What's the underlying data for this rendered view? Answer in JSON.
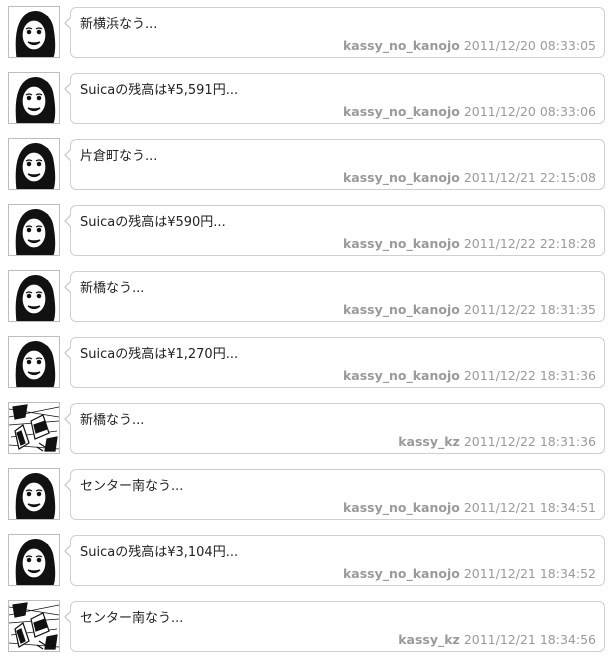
{
  "timeline": {
    "items": [
      {
        "avatar": "girl-face-icon",
        "text": "新横浜なう...",
        "user": "kassy_no_kanojo",
        "time": "2011/12/20 08:33:05"
      },
      {
        "avatar": "girl-face-icon",
        "text": "Suicaの残高は¥5,591円...",
        "user": "kassy_no_kanojo",
        "time": "2011/12/20 08:33:06"
      },
      {
        "avatar": "girl-face-icon",
        "text": "片倉町なう...",
        "user": "kassy_no_kanojo",
        "time": "2011/12/21 22:15:08"
      },
      {
        "avatar": "girl-face-icon",
        "text": "Suicaの残高は¥590円...",
        "user": "kassy_no_kanojo",
        "time": "2011/12/22 22:18:28"
      },
      {
        "avatar": "girl-face-icon",
        "text": "新橋なう...",
        "user": "kassy_no_kanojo",
        "time": "2011/12/22 18:31:35"
      },
      {
        "avatar": "girl-face-icon",
        "text": "Suicaの残高は¥1,270円...",
        "user": "kassy_no_kanojo",
        "time": "2011/12/22 18:31:36"
      },
      {
        "avatar": "manga-panel-icon",
        "text": "新橋なう...",
        "user": "kassy_kz",
        "time": "2011/12/22 18:31:36"
      },
      {
        "avatar": "girl-face-icon",
        "text": "センター南なう...",
        "user": "kassy_no_kanojo",
        "time": "2011/12/21 18:34:51"
      },
      {
        "avatar": "girl-face-icon",
        "text": "Suicaの残高は¥3,104円...",
        "user": "kassy_no_kanojo",
        "time": "2011/12/21 18:34:52"
      },
      {
        "avatar": "manga-panel-icon",
        "text": "センター南なう...",
        "user": "kassy_kz",
        "time": "2011/12/21 18:34:56"
      }
    ]
  }
}
